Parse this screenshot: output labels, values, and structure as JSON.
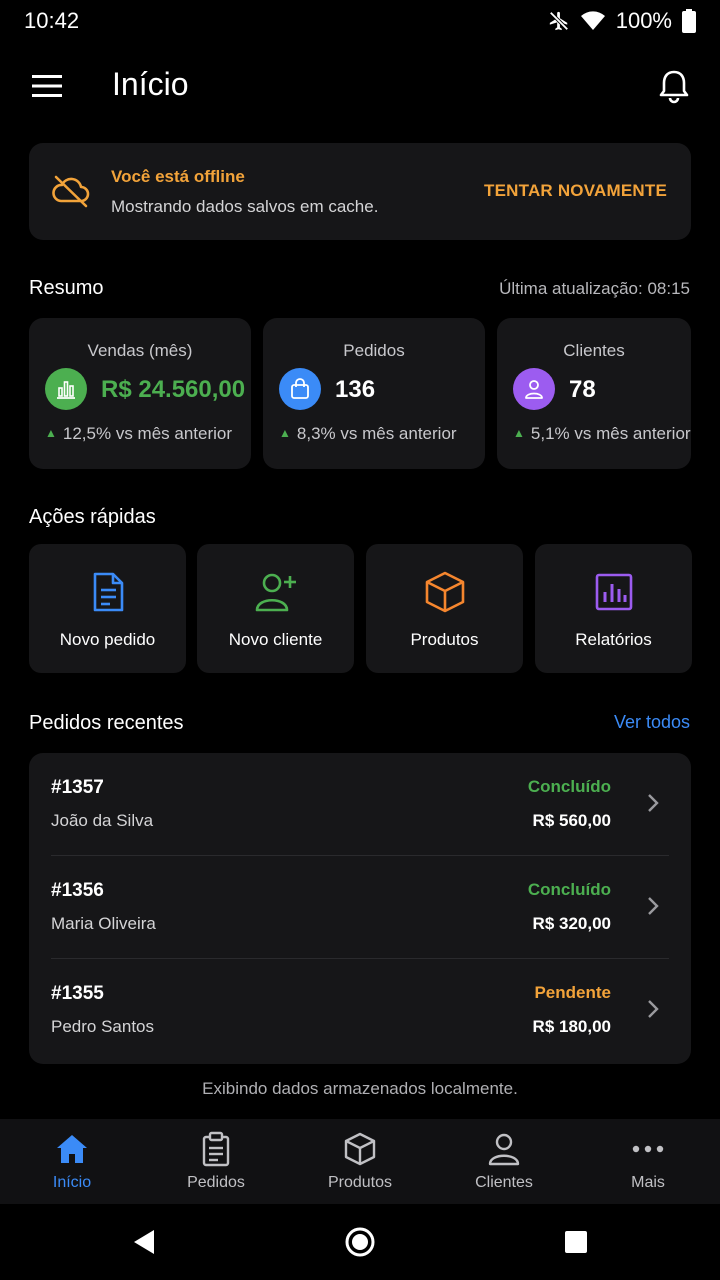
{
  "status_bar": {
    "time": "10:42",
    "battery": "100%"
  },
  "app_bar": {
    "title": "Início"
  },
  "offline_banner": {
    "title": "Você está offline",
    "subtitle": "Mostrando dados salvos em cache.",
    "retry_label": "TENTAR NOVAMENTE"
  },
  "summary": {
    "title": "Resumo",
    "last_update": "Última atualização: 08:15",
    "cards": [
      {
        "label": "Vendas (mês)",
        "value": "R$ 24.560,00",
        "delta": "12,5%",
        "delta_text": " vs mês anterior",
        "icon": "chart-icon",
        "icon_color": "#4CAF50",
        "value_color": "#4CAF50"
      },
      {
        "label": "Pedidos",
        "value": "136",
        "delta": "8,3%",
        "delta_text": " vs mês anterior",
        "icon": "shopping-bag-icon",
        "icon_color": "#3B8BF7",
        "value_color": "#FFFFFF"
      },
      {
        "label": "Clientes",
        "value": "78",
        "delta": "5,1%",
        "delta_text": " vs mês anterior",
        "icon": "person-icon",
        "icon_color": "#9C5CF0",
        "value_color": "#FFFFFF"
      }
    ]
  },
  "quick_actions": {
    "title": "Ações rápidas",
    "items": [
      {
        "label": "Novo pedido",
        "icon": "document-icon",
        "color": "#3B8BF7"
      },
      {
        "label": "Novo cliente",
        "icon": "add-user-icon",
        "color": "#4CAF50"
      },
      {
        "label": "Produtos",
        "icon": "box-icon",
        "color": "#F5862E"
      },
      {
        "label": "Relatórios",
        "icon": "report-icon",
        "color": "#9C5CF0"
      }
    ]
  },
  "recent_orders": {
    "title": "Pedidos recentes",
    "see_all": "Ver todos",
    "orders": [
      {
        "id": "#1357",
        "customer": "João da Silva",
        "status": "Concluído",
        "status_color": "#4CAF50",
        "amount": "R$ 560,00"
      },
      {
        "id": "#1356",
        "customer": "Maria Oliveira",
        "status": "Concluído",
        "status_color": "#4CAF50",
        "amount": "R$ 320,00"
      },
      {
        "id": "#1355",
        "customer": "Pedro Santos",
        "status": "Pendente",
        "status_color": "#F2A33A",
        "amount": "R$ 180,00"
      }
    ]
  },
  "footer_note": "Exibindo dados armazenados localmente.",
  "bottom_nav": {
    "items": [
      {
        "label": "Início",
        "icon": "home-icon",
        "active": true
      },
      {
        "label": "Pedidos",
        "icon": "clipboard-icon",
        "active": false
      },
      {
        "label": "Produtos",
        "icon": "box-icon",
        "active": false
      },
      {
        "label": "Clientes",
        "icon": "person-icon",
        "active": false
      },
      {
        "label": "Mais",
        "icon": "more-icon",
        "active": false
      }
    ]
  },
  "colors": {
    "accent": "#3B8BF7",
    "warning": "#F2A33A",
    "success": "#4CAF50",
    "card": "#161618"
  }
}
